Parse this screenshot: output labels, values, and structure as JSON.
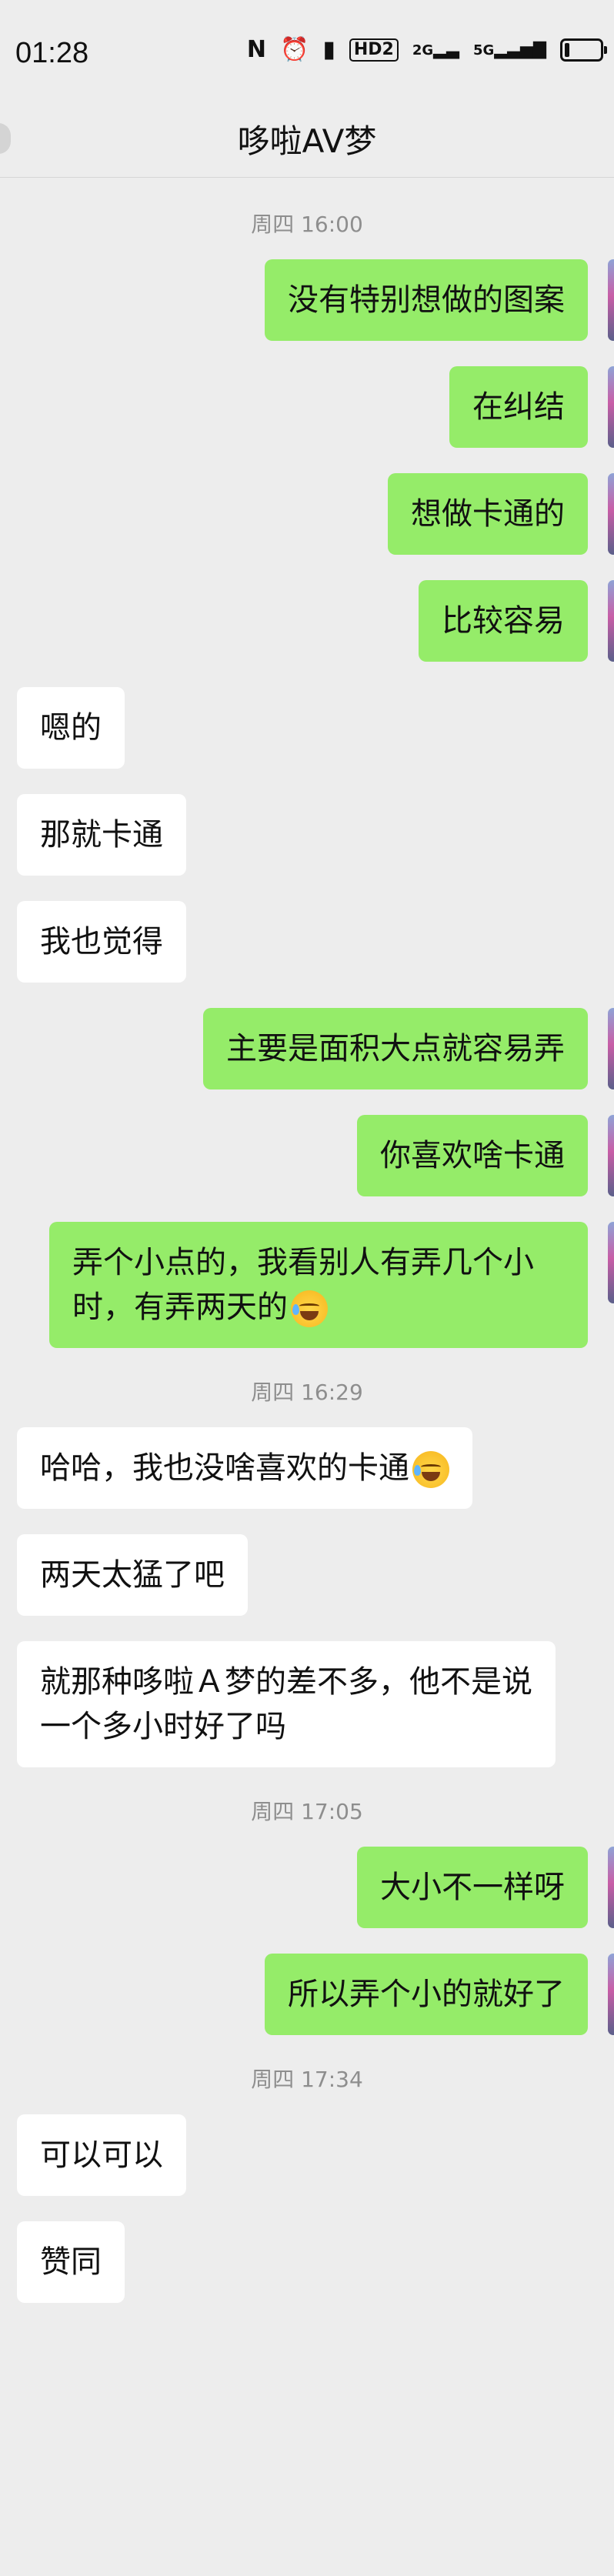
{
  "status_bar": {
    "time": "01:28",
    "icons": [
      "nfc-icon",
      "alarm-icon",
      "vibrate-icon",
      "hd-icon",
      "signal-2g-icon",
      "signal-5g-icon",
      "battery-icon"
    ],
    "hd_label": "HD2",
    "net1_label": "2G",
    "net2_label": "5G"
  },
  "header": {
    "title": "哆啦AV梦"
  },
  "colors": {
    "background": "#ededed",
    "outgoing_bubble": "#95ec69",
    "incoming_bubble": "#ffffff",
    "timestamp_text": "#8e8e8e"
  },
  "conversation": [
    {
      "type": "time",
      "text": "周四 16:00"
    },
    {
      "type": "msg",
      "side": "out",
      "text": "没有特别想做的图案"
    },
    {
      "type": "msg",
      "side": "out",
      "text": "在纠结"
    },
    {
      "type": "msg",
      "side": "out",
      "text": "想做卡通的"
    },
    {
      "type": "msg",
      "side": "out",
      "text": "比较容易"
    },
    {
      "type": "msg",
      "side": "in",
      "text": "嗯的"
    },
    {
      "type": "msg",
      "side": "in",
      "text": "那就卡通"
    },
    {
      "type": "msg",
      "side": "in",
      "text": "我也觉得"
    },
    {
      "type": "msg",
      "side": "out",
      "text": "主要是面积大点就容易弄"
    },
    {
      "type": "msg",
      "side": "out",
      "text": "你喜欢啥卡通"
    },
    {
      "type": "msg",
      "side": "out",
      "text": "弄个小点的，我看别人有弄几个小时，有弄两天的",
      "emoji": "laugh-cry-icon"
    },
    {
      "type": "time",
      "text": "周四 16:29"
    },
    {
      "type": "msg",
      "side": "in",
      "text": "哈哈，我也没啥喜欢的卡通",
      "emoji": "laugh-cry-icon"
    },
    {
      "type": "msg",
      "side": "in",
      "text": "两天太猛了吧"
    },
    {
      "type": "msg",
      "side": "in",
      "text": "就那种哆啦Ａ梦的差不多，他不是说一个多小时好了吗"
    },
    {
      "type": "time",
      "text": "周四 17:05"
    },
    {
      "type": "msg",
      "side": "out",
      "text": "大小不一样呀"
    },
    {
      "type": "msg",
      "side": "out",
      "text": "所以弄个小的就好了"
    },
    {
      "type": "time",
      "text": "周四 17:34"
    },
    {
      "type": "msg",
      "side": "in",
      "text": "可以可以"
    },
    {
      "type": "msg",
      "side": "in",
      "text": "赞同"
    }
  ]
}
